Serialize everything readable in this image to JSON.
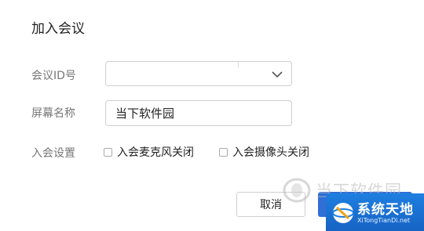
{
  "dialog": {
    "title": "加入会议"
  },
  "form": {
    "meeting_id_label": "会议ID号",
    "meeting_id_value": "",
    "display_name_label": "屏幕名称",
    "display_name_value": "当下软件园",
    "join_settings_label": "入会设置",
    "options": [
      {
        "label": "入会麦克风关闭",
        "checked": false
      },
      {
        "label": "入会摄像头关闭",
        "checked": false
      }
    ]
  },
  "footer": {
    "cancel_label": "取消",
    "join_label": ""
  },
  "watermark": {
    "site_text": "当下软件园",
    "badge_title": "系统天地",
    "badge_url": "XiTongTianDi.net",
    "colors": {
      "badge": "#1e7fe0",
      "faded_text": "#b8b8b8"
    }
  },
  "colors": {
    "accent": "#2f6fd6",
    "border": "#cfcfcf",
    "label": "#777777"
  }
}
